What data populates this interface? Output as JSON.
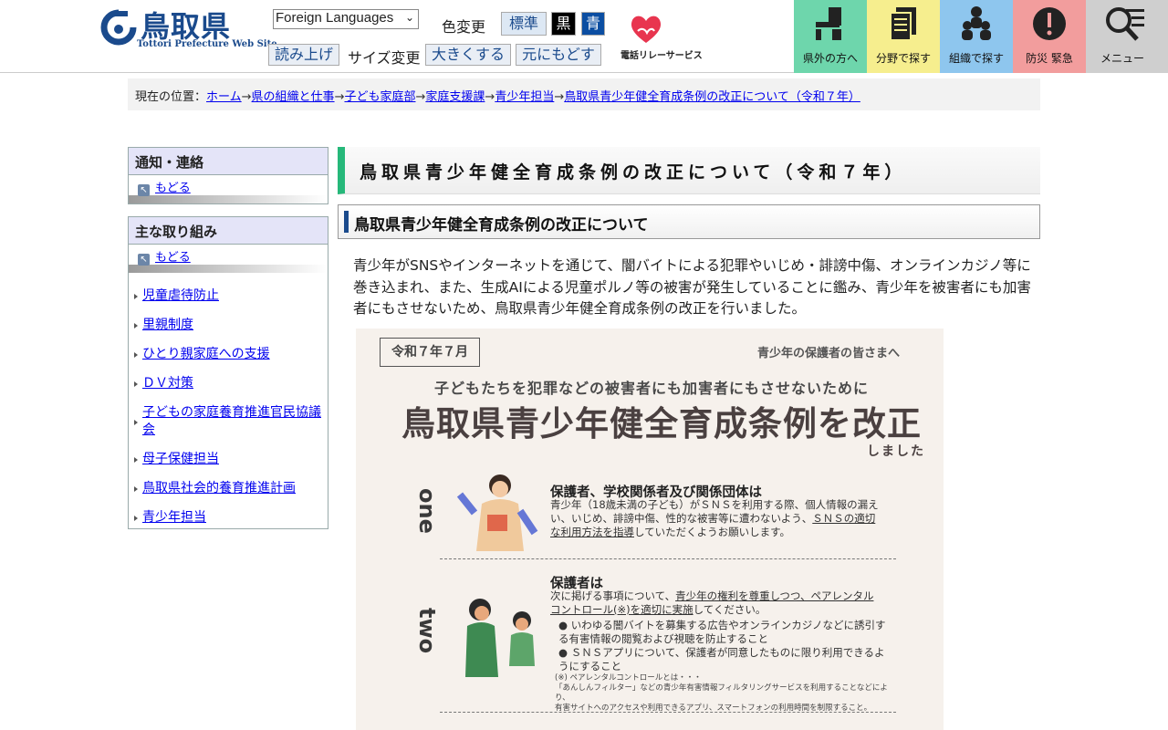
{
  "header": {
    "logo_name": "鳥取県",
    "logo_sub": "Tottori Prefecture Web Site",
    "language_select": "Foreign Languages",
    "color_label": "色変更",
    "color_standard": "標準",
    "color_black": "黒",
    "color_blue": "青",
    "read_aloud": "読み上げ",
    "size_label": "サイズ変更",
    "size_larger": "大きくする",
    "size_reset": "元にもどす",
    "relay_text": "電話リレーサービス",
    "nav": [
      {
        "label": "県外の方へ",
        "icon": "outside-visitor-icon"
      },
      {
        "label": "分野で探す",
        "icon": "documents-icon"
      },
      {
        "label": "組織で探す",
        "icon": "people-icon"
      },
      {
        "label": "防災 緊急",
        "icon": "alert-icon"
      },
      {
        "label": "メニュー",
        "icon": "search-menu-icon"
      }
    ],
    "accent_colors": [
      "#6ed6ac",
      "#f6ee8e",
      "#8ec6ee",
      "#f29d9d",
      "#cfcfcf"
    ]
  },
  "breadcrumb": {
    "prefix": "現在の位置：",
    "items": [
      "ホーム",
      "県の組織と仕事",
      "子ども家庭部",
      "家庭支援課",
      "青少年担当",
      "鳥取県青少年健全育成条例の改正について（令和７年）"
    ],
    "separator": "→"
  },
  "sidebar": {
    "notice": {
      "heading": "通知・連絡",
      "back": "もどる"
    },
    "main": {
      "heading": "主な取り組み",
      "back": "もどる",
      "items": [
        "児童虐待防止",
        "里親制度",
        "ひとり親家庭への支援",
        "ＤＶ対策",
        "子どもの家庭養育推進官民協議会",
        "母子保健担当",
        "鳥取県社会的養育推進計画",
        "青少年担当"
      ]
    }
  },
  "main": {
    "title": "鳥取県青少年健全育成条例の改正について（令和７年）",
    "subtitle": "鳥取県青少年健全育成条例の改正について",
    "body": "青少年がSNSやインターネットを通じて、闇バイトによる犯罪やいじめ・誹謗中傷、オンラインカジノ等に巻き込まれ、また、生成AIによる児童ポルノ等の被害が発生していることに鑑み、青少年を被害者にも加害者にもさせないため、鳥取県青少年健全育成条例の改正を行いました。"
  },
  "flyer": {
    "date": "令和７年７月",
    "audience": "青少年の保護者の皆さまへ",
    "lead": "子どもたちを犯罪などの被害者にも加害者にもさせないために",
    "title": "鳥取県青少年健全育成条例を改正",
    "title_suffix": "しました",
    "sections": [
      {
        "number": "one",
        "heading": "保護者、学校関係者及び関係団体は",
        "text_1": "青少年（18歳未満の子ども）がＳＮＳを利用する際、個人情報の漏え",
        "text_2": "い、いじめ、誹謗中傷、性的な被害等に遭わないよう、",
        "text_link_1": "ＳＮＳの適切",
        "text_link_2": "な利用方法を指導",
        "text_3": "していただくようお願いします。"
      },
      {
        "number": "two",
        "heading": "保護者は",
        "text_1": "次に掲げる事項について、",
        "text_link_1": "青少年の権利を尊重しつつ、ペアレンタル",
        "text_link_2": "コントロール(※)を適切に実施",
        "text_3": "してください。",
        "bullets": [
          "いわゆる闇バイトを募集する広告やオンラインカジノなどに誘引する有害情報の閲覧および視聴を防止すること",
          "ＳＮＳアプリについて、保護者が同意したものに限り利用できるようにすること"
        ],
        "note_1": "(※) ペアレンタルコントロールとは・・・",
        "note_2": "「あんしんフィルター」などの青少年有害情報フィルタリングサービスを利用することなどにより、",
        "note_3": "有害サイトへのアクセスや利用できるアプリ、スマートフォンの利用時間を制限すること。"
      }
    ]
  }
}
